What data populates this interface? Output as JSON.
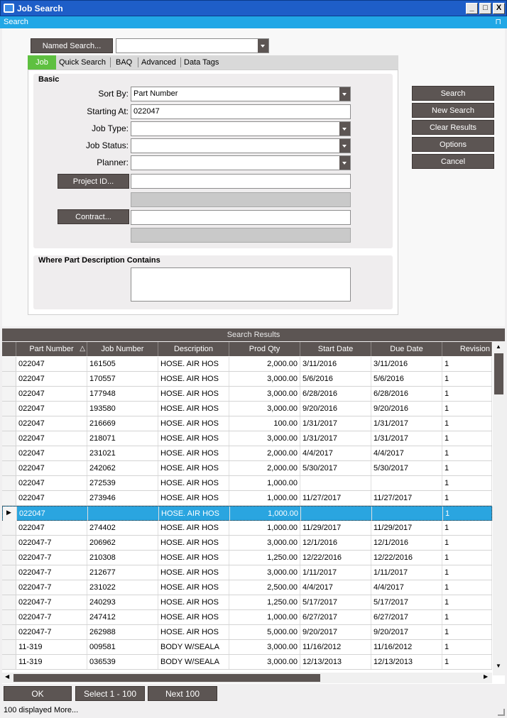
{
  "window": {
    "title": "Job Search",
    "minimize": "_",
    "maximize": "□",
    "close": "X"
  },
  "searchbar": {
    "label": "Search",
    "pin": "⊓"
  },
  "named_search": {
    "button": "Named Search...",
    "value": ""
  },
  "tabs": [
    "Job",
    "Quick Search",
    "BAQ",
    "Advanced",
    "Data Tags"
  ],
  "basic": {
    "title": "Basic",
    "sort_by_label": "Sort By:",
    "sort_by_value": "Part Number",
    "starting_at_label": "Starting At:",
    "starting_at_value": "022047",
    "job_type_label": "Job Type:",
    "job_type_value": "",
    "job_status_label": "Job Status:",
    "job_status_value": "",
    "planner_label": "Planner:",
    "planner_value": "",
    "project_button": "Project ID...",
    "project_value": "",
    "contract_button": "Contract...",
    "contract_value": ""
  },
  "where_desc": {
    "title": "Where Part Description Contains",
    "value": ""
  },
  "actions": {
    "search": "Search",
    "new_search": "New Search",
    "clear": "Clear Results",
    "options": "Options",
    "cancel": "Cancel"
  },
  "results": {
    "header": "Search Results",
    "columns": [
      "Part Number",
      "Job Number",
      "Description",
      "Prod Qty",
      "Start Date",
      "Due Date",
      "Revision"
    ],
    "sort_indicator": "△",
    "rows": [
      [
        "022047",
        "161505",
        "HOSE. AIR HOS",
        "2,000.00",
        "3/11/2016",
        "3/11/2016",
        "1"
      ],
      [
        "022047",
        "170557",
        "HOSE. AIR HOS",
        "3,000.00",
        "5/6/2016",
        "5/6/2016",
        "1"
      ],
      [
        "022047",
        "177948",
        "HOSE. AIR HOS",
        "3,000.00",
        "6/28/2016",
        "6/28/2016",
        "1"
      ],
      [
        "022047",
        "193580",
        "HOSE. AIR HOS",
        "3,000.00",
        "9/20/2016",
        "9/20/2016",
        "1"
      ],
      [
        "022047",
        "216669",
        "HOSE. AIR HOS",
        "100.00",
        "1/31/2017",
        "1/31/2017",
        "1"
      ],
      [
        "022047",
        "218071",
        "HOSE. AIR HOS",
        "3,000.00",
        "1/31/2017",
        "1/31/2017",
        "1"
      ],
      [
        "022047",
        "231021",
        "HOSE. AIR HOS",
        "2,000.00",
        "4/4/2017",
        "4/4/2017",
        "1"
      ],
      [
        "022047",
        "242062",
        "HOSE. AIR HOS",
        "2,000.00",
        "5/30/2017",
        "5/30/2017",
        "1"
      ],
      [
        "022047",
        "272539",
        "HOSE. AIR HOS",
        "1,000.00",
        "",
        "",
        "1"
      ],
      [
        "022047",
        "273946",
        "HOSE. AIR HOS",
        "1,000.00",
        "11/27/2017",
        "11/27/2017",
        "1"
      ],
      [
        "022047",
        "",
        "HOSE. AIR HOS",
        "1,000.00",
        "",
        "",
        "1"
      ],
      [
        "022047",
        "274402",
        "HOSE. AIR HOS",
        "1,000.00",
        "11/29/2017",
        "11/29/2017",
        "1"
      ],
      [
        "022047-7",
        "206962",
        "HOSE. AIR HOS",
        "3,000.00",
        "12/1/2016",
        "12/1/2016",
        "1"
      ],
      [
        "022047-7",
        "210308",
        "HOSE. AIR HOS",
        "1,250.00",
        "12/22/2016",
        "12/22/2016",
        "1"
      ],
      [
        "022047-7",
        "212677",
        "HOSE. AIR HOS",
        "3,000.00",
        "1/11/2017",
        "1/11/2017",
        "1"
      ],
      [
        "022047-7",
        "231022",
        "HOSE. AIR HOS",
        "2,500.00",
        "4/4/2017",
        "4/4/2017",
        "1"
      ],
      [
        "022047-7",
        "240293",
        "HOSE. AIR HOS",
        "1,250.00",
        "5/17/2017",
        "5/17/2017",
        "1"
      ],
      [
        "022047-7",
        "247412",
        "HOSE. AIR HOS",
        "1,000.00",
        "6/27/2017",
        "6/27/2017",
        "1"
      ],
      [
        "022047-7",
        "262988",
        "HOSE. AIR HOS",
        "5,000.00",
        "9/20/2017",
        "9/20/2017",
        "1"
      ],
      [
        "11-319",
        "009581",
        "BODY W/SEALA",
        "3,000.00",
        "11/16/2012",
        "11/16/2012",
        "1"
      ],
      [
        "11-319",
        "036539",
        "BODY W/SEALA",
        "3,000.00",
        "12/13/2013",
        "12/13/2013",
        "1"
      ]
    ],
    "selected_row": 10
  },
  "footer": {
    "ok": "OK",
    "select": "Select 1 - 100",
    "next": "Next 100",
    "status": "100 displayed More..."
  },
  "colors": {
    "accent_blue": "#21a7e6",
    "title_blue": "#1e5ec8",
    "button_dark": "#5c5553",
    "tab_green": "#5ec040"
  }
}
